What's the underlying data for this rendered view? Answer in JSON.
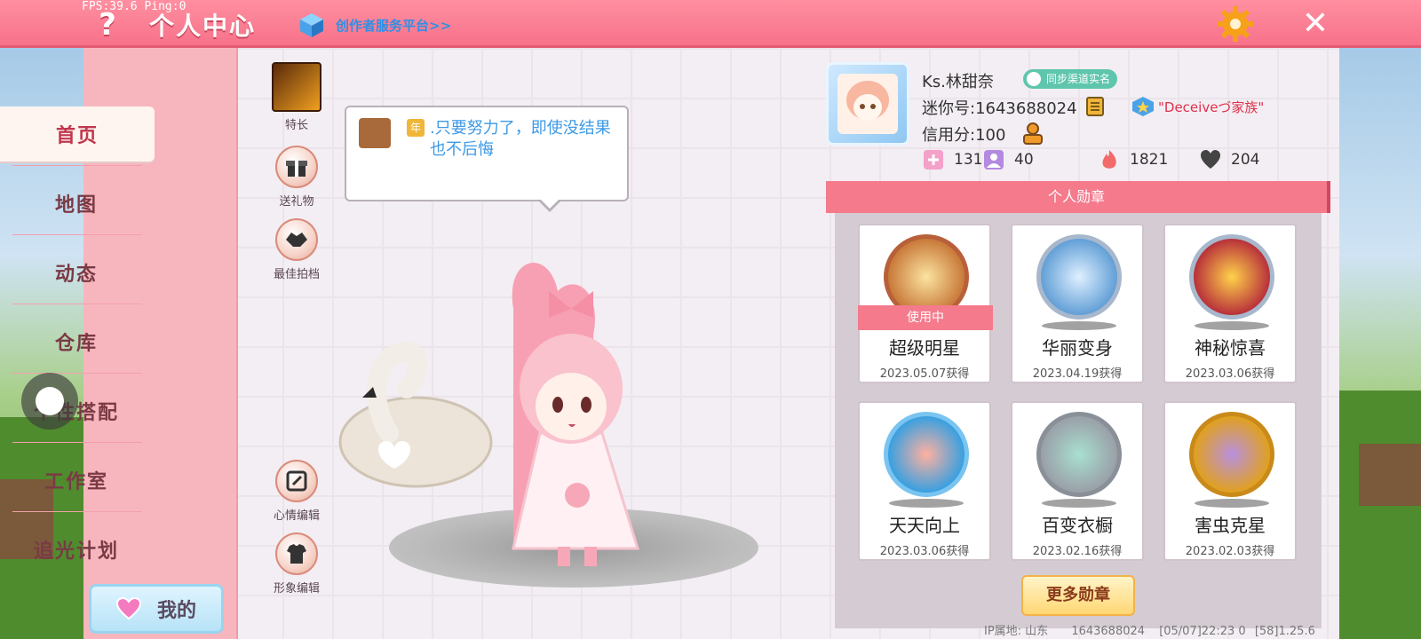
{
  "status": {
    "fps": "FPS:39.6  Ping:0"
  },
  "header": {
    "help_icon": "question-icon",
    "title": "个人中心",
    "platform_link": "创作者服务平台>>",
    "settings_icon": "gear-icon",
    "close_icon": "close-icon"
  },
  "sidebar": {
    "items": [
      {
        "label": "首页",
        "active": true
      },
      {
        "label": "地图"
      },
      {
        "label": "动态"
      },
      {
        "label": "仓库"
      },
      {
        "label": "个性搭配"
      },
      {
        "label": "工作室"
      },
      {
        "label": "追光计划"
      }
    ],
    "mine_label": "我的"
  },
  "actions": {
    "skill": "特长",
    "gift": "送礼物",
    "partner": "最佳拍档",
    "mood_edit": "心情编辑",
    "avatar_edit": "形象编辑"
  },
  "bubble": {
    "badge_label": "年",
    "text": ".只要努力了，即使没结果也不后悔"
  },
  "profile": {
    "username": "Ks.林甜奈",
    "realname_badge": "同步渠道实名",
    "mini_id": "迷你号:1643688024",
    "clan": "\"Deceiveづ家族\"",
    "credit": "信用分:100",
    "stats": [
      {
        "icon": "add-friend-icon",
        "value": "131"
      },
      {
        "icon": "fans-icon",
        "value": "40"
      },
      {
        "icon": "fire-icon",
        "value": "1821"
      },
      {
        "icon": "like-icon",
        "value": "204"
      }
    ]
  },
  "medals": {
    "header": "个人勋章",
    "in_use_label": "使用中",
    "items": [
      {
        "name": "超级明星",
        "date": "2023.05.07获得",
        "in_use": true,
        "color": "#c97a3a"
      },
      {
        "name": "华丽变身",
        "date": "2023.04.19获得",
        "color": "#5a9ad4"
      },
      {
        "name": "神秘惊喜",
        "date": "2023.03.06获得",
        "color": "#b8323a"
      },
      {
        "name": "天天向上",
        "date": "2023.03.06获得",
        "color": "#3aa0e0"
      },
      {
        "name": "百变衣橱",
        "date": "2023.02.16获得",
        "color": "#9aa0a8"
      },
      {
        "name": "害虫克星",
        "date": "2023.02.03获得",
        "color": "#e0a020"
      }
    ],
    "more_label": "更多勋章"
  },
  "footer": {
    "ip_label": "IP属地: 山东",
    "id": "1643688024",
    "timestamp": "[05/07]22:23 0",
    "version": "[58]1.25.6"
  },
  "colors": {
    "accent": "#f47a8c",
    "link": "#2f8fe6",
    "clan": "#e0304a"
  }
}
